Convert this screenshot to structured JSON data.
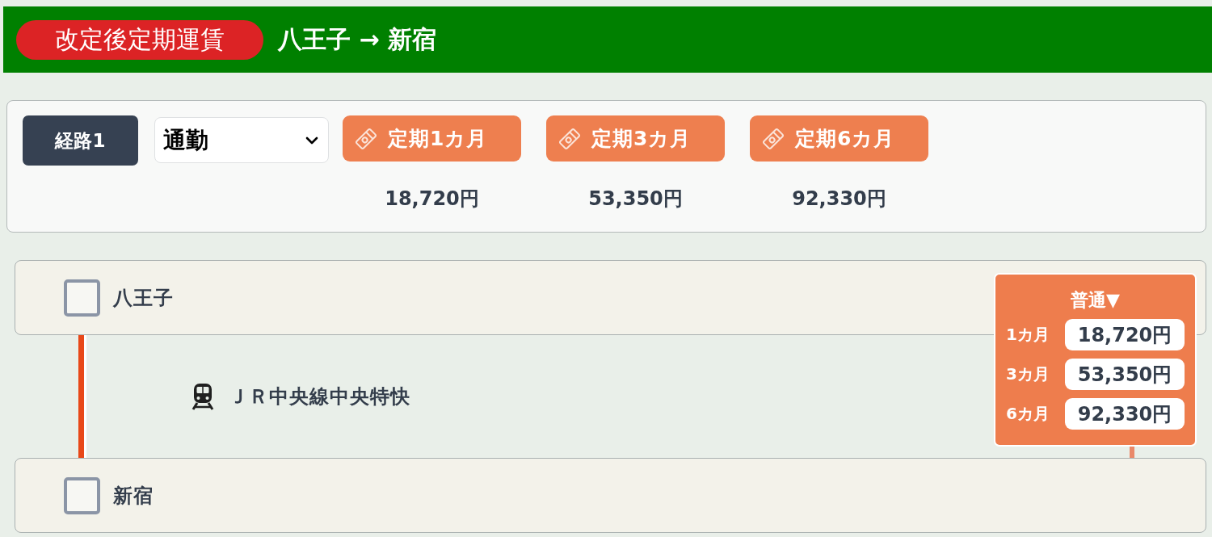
{
  "header": {
    "badge": "改定後定期運賃",
    "route_title": "八王子 → 新宿"
  },
  "summary": {
    "route_label": "経路1",
    "purpose_select": {
      "value": "通勤"
    },
    "passes": [
      {
        "label": "定期1カ月",
        "price": "18,720円"
      },
      {
        "label": "定期3カ月",
        "price": "53,350円"
      },
      {
        "label": "定期6カ月",
        "price": "92,330円"
      }
    ]
  },
  "route": {
    "stations": [
      {
        "name": "八王子",
        "checked": false
      },
      {
        "name": "新宿",
        "checked": false
      }
    ],
    "segments": [
      {
        "line": "ＪＲ中央線中央特快",
        "color": "#e84818"
      }
    ],
    "fare_popup": {
      "type_toggle": "普通▼",
      "rows": [
        {
          "period": "1カ月",
          "price": "18,720円"
        },
        {
          "period": "3カ月",
          "price": "53,350円"
        },
        {
          "period": "6カ月",
          "price": "92,330円"
        }
      ]
    }
  }
}
